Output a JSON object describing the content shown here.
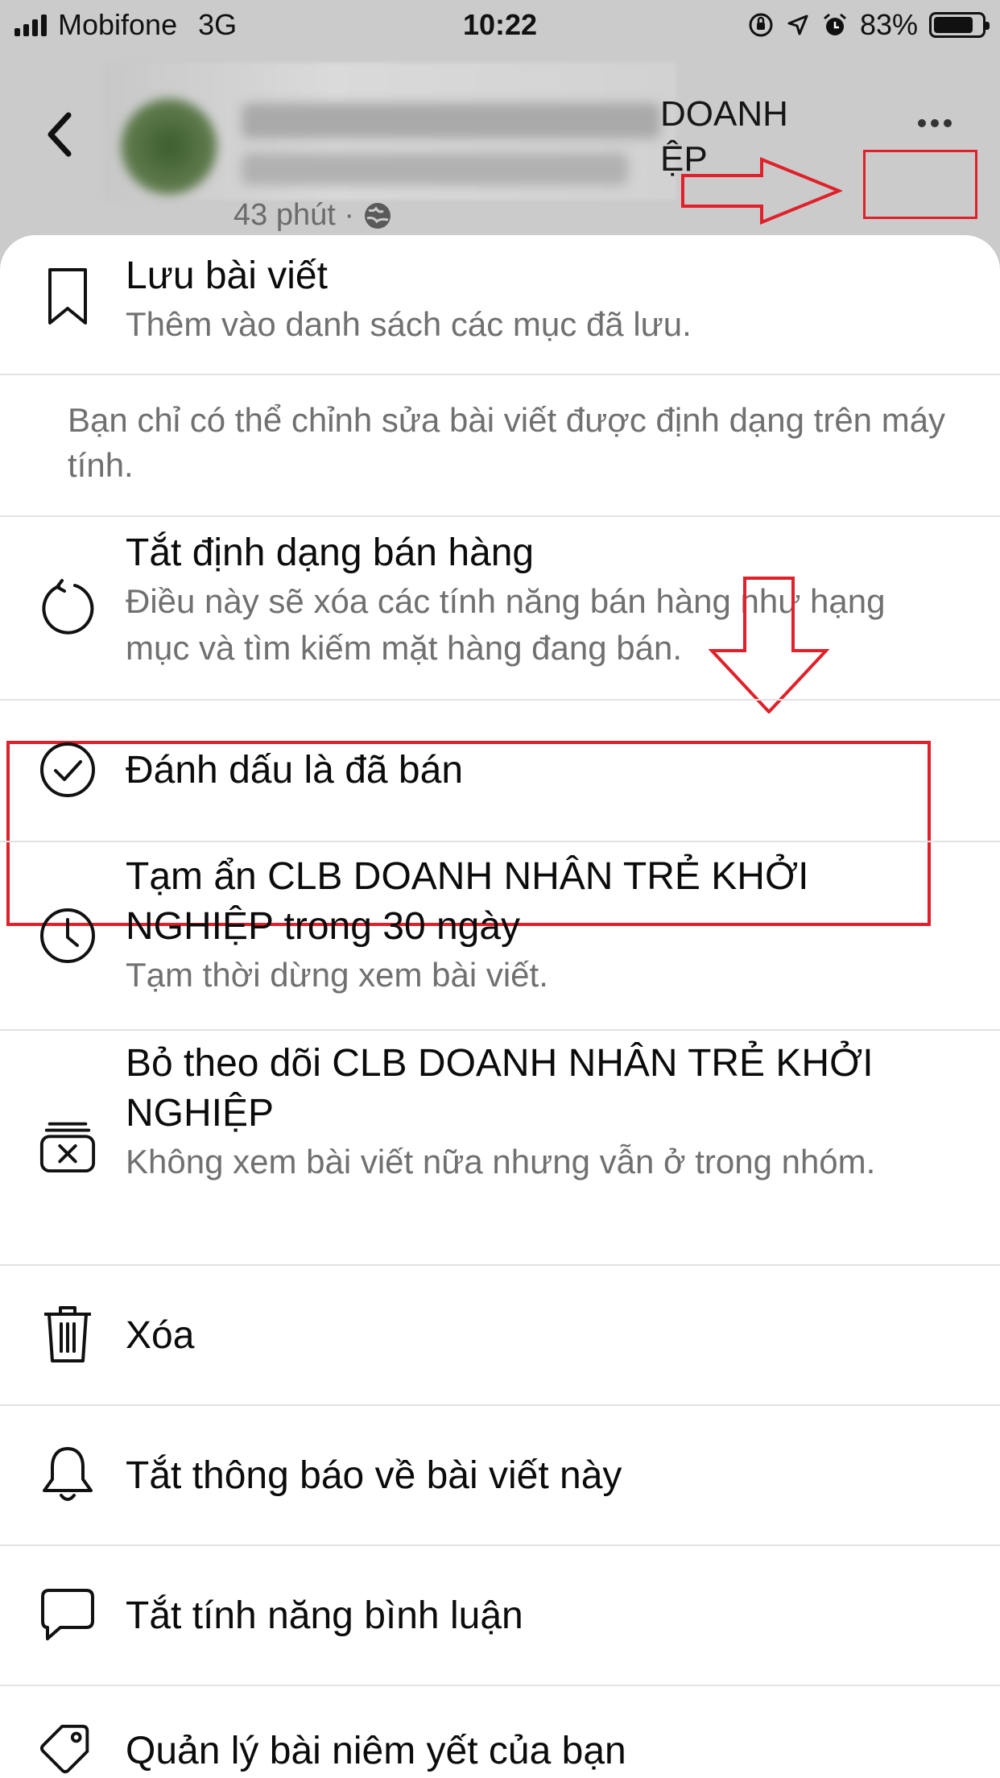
{
  "status_bar": {
    "carrier": "Mobifone",
    "network": "3G",
    "time": "10:22",
    "battery": "83%",
    "battery_level": 0.83
  },
  "header": {
    "title_visible": "DOANH\nỆP",
    "post_time": "43 phút ·"
  },
  "menu": {
    "save": {
      "title": "Lưu bài viết",
      "subtitle": "Thêm vào danh sách các mục đã lưu."
    },
    "edit_notice": "Bạn chỉ có thể chỉnh sửa bài viết được định dạng trên máy tính.",
    "turn_off_sell": {
      "title": "Tắt định dạng bán hàng",
      "subtitle": "Điều này sẽ xóa các tính năng bán hàng như hạng mục và tìm kiếm mặt hàng đang bán."
    },
    "mark_sold": {
      "title": "Đánh dấu là đã bán"
    },
    "snooze": {
      "title": "Tạm ẩn CLB DOANH NHÂN TRẺ KHỞI NGHIỆP trong 30 ngày",
      "subtitle": "Tạm thời dừng xem bài viết."
    },
    "unfollow": {
      "title": "Bỏ theo dõi CLB DOANH NHÂN TRẺ KHỞI NGHIỆP",
      "subtitle": "Không xem bài viết nữa nhưng vẫn ở trong nhóm."
    },
    "delete": {
      "title": "Xóa"
    },
    "notifications_off": {
      "title": "Tắt thông báo về bài viết này"
    },
    "comments_off": {
      "title": "Tắt tính năng bình luận"
    },
    "manage_listings": {
      "title": "Quản lý bài niêm yết của bạn"
    }
  },
  "colors": {
    "annotation": "#e0202a",
    "overlay": "#cbcbcb",
    "sheet": "#ffffff",
    "secondary_text": "#707070"
  },
  "icons": [
    "signal-icon",
    "location-icon",
    "alarm-icon",
    "lock-rotation-icon",
    "battery-icon",
    "back-icon",
    "more-icon",
    "globe-icon",
    "bookmark-icon",
    "refresh-icon",
    "check-circle-icon",
    "clock-icon",
    "unfollow-icon",
    "trash-icon",
    "bell-icon",
    "comment-icon",
    "tag-icon"
  ]
}
